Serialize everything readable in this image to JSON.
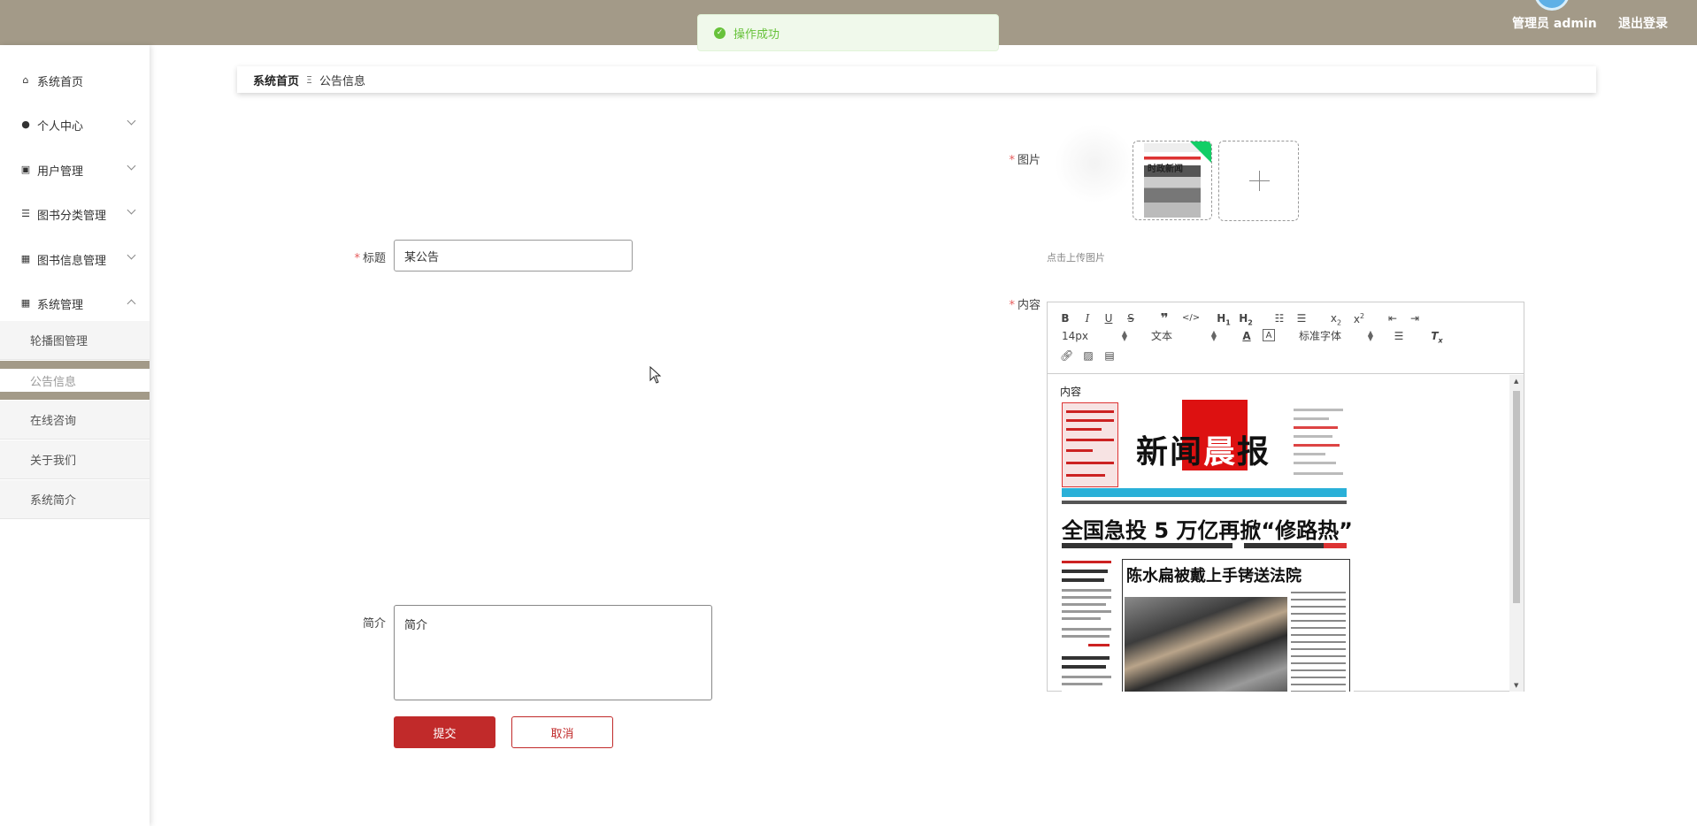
{
  "header": {
    "user_label": "管理员 admin",
    "logout_label": "退出登录"
  },
  "toast": {
    "message": "操作成功"
  },
  "sidebar": {
    "items": [
      {
        "label": "系统首页",
        "icon": "home-icon"
      },
      {
        "label": "个人中心",
        "icon": "user-icon"
      },
      {
        "label": "用户管理",
        "icon": "clipboard-icon"
      },
      {
        "label": "图书分类管理",
        "icon": "list-icon"
      },
      {
        "label": "图书信息管理",
        "icon": "grid-icon"
      },
      {
        "label": "系统管理",
        "icon": "grid-icon"
      }
    ],
    "subitems": [
      {
        "label": "轮播图管理"
      },
      {
        "label": "公告信息",
        "active": true
      },
      {
        "label": "在线咨询"
      },
      {
        "label": "关于我们"
      },
      {
        "label": "系统简介"
      }
    ]
  },
  "breadcrumb": {
    "home": "系统首页",
    "current": "公告信息"
  },
  "form": {
    "title_label": "标题",
    "title_value": "某公告",
    "summary_label": "简介",
    "summary_value": "简介",
    "image_label": "图片",
    "upload_hint": "点击上传图片",
    "content_label": "内容",
    "submit_label": "提交",
    "cancel_label": "取消"
  },
  "thumbnail": {
    "caption": "时政新闻"
  },
  "editor": {
    "font_size": "14px",
    "header_select": "文本",
    "font_family": "标准字体",
    "content_text": "内容"
  },
  "newspaper": {
    "masthead_left": "新闻",
    "masthead_mid": "晨",
    "masthead_right": "报",
    "headline": "全国急投 5 万亿再掀“修路热”",
    "box_title": "陈水扁被戴上手铐送法院"
  }
}
